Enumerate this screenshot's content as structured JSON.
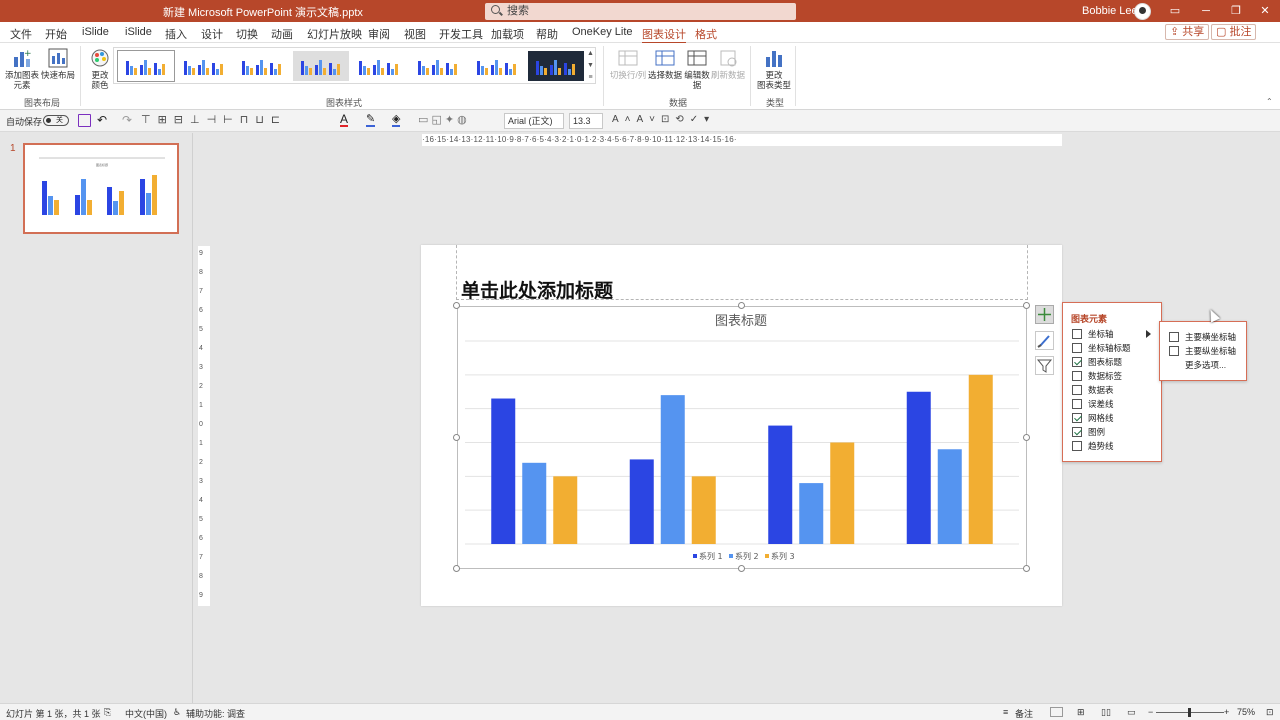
{
  "window": {
    "title": "新建 Microsoft PowerPoint 演示文稿.pptx",
    "search_placeholder": "搜索",
    "user_name": "Bobbie Lee"
  },
  "menu": {
    "tabs": [
      "文件",
      "开始",
      "iSlide",
      "iSlide",
      "插入",
      "设计",
      "切换",
      "动画",
      "幻灯片放映",
      "审阅",
      "视图",
      "开发工具",
      "加载项",
      "帮助",
      "OneKey Lite",
      "图表设计",
      "格式"
    ],
    "active_tab": "图表设计",
    "share_label": "共享",
    "comment_label": "批注"
  },
  "ribbon": {
    "add_chart_element": "添加图表\n元素",
    "quick_layout": "快速布局",
    "change_colors": "更改\n颜色",
    "switch_row_col": "切换行/列",
    "select_data": "选择数据",
    "edit_data": "编辑数\n据",
    "refresh_data": "刷新数据",
    "change_chart_type": "更改\n图表类型",
    "groups": {
      "layouts": "图表布局",
      "styles": "图表样式",
      "data": "数据",
      "type": "类型"
    }
  },
  "format_bar": {
    "autosave_label": "自动保存",
    "autosave_state": "关",
    "font_name": "Arial (正文)",
    "font_size": "13.3"
  },
  "ruler": {
    "horizontal": "·16·15·14·13·12·11·10·9·8·7·6·5·4·3·2·1·0·1·2·3·4·5·6·7·8·9·10·11·12·13·14·15·16·",
    "vertical": [
      "9",
      "8",
      "7",
      "6",
      "5",
      "4",
      "3",
      "2",
      "1",
      "0",
      "1",
      "2",
      "3",
      "4",
      "5",
      "6",
      "7",
      "8",
      "9"
    ]
  },
  "slides_panel": {
    "slide_number": "1"
  },
  "slide": {
    "title": "单击此处添加标题"
  },
  "chart_data": {
    "type": "bar",
    "title": "图表标题",
    "categories": [
      "",
      "",
      "",
      ""
    ],
    "series": [
      {
        "name": "系列 1",
        "values": [
          4.3,
          2.5,
          3.5,
          4.5
        ],
        "color": "#2b45e3"
      },
      {
        "name": "系列 2",
        "values": [
          2.4,
          4.4,
          1.8,
          2.8
        ],
        "color": "#5594f0"
      },
      {
        "name": "系列 3",
        "values": [
          2.0,
          2.0,
          3.0,
          5.0
        ],
        "color": "#f2ae32"
      }
    ],
    "ylim": [
      0,
      6
    ],
    "grid": true,
    "legend": "bottom"
  },
  "chart_elements_flyout": {
    "title": "图表元素",
    "items": [
      {
        "label": "坐标轴",
        "checked": false
      },
      {
        "label": "坐标轴标题",
        "checked": false
      },
      {
        "label": "图表标题",
        "checked": true
      },
      {
        "label": "数据标签",
        "checked": false
      },
      {
        "label": "数据表",
        "checked": false
      },
      {
        "label": "误差线",
        "checked": false
      },
      {
        "label": "网格线",
        "checked": true
      },
      {
        "label": "图例",
        "checked": true
      },
      {
        "label": "趋势线",
        "checked": false
      }
    ],
    "submenu": {
      "items": [
        "主要横坐标轴",
        "主要纵坐标轴"
      ],
      "more": "更多选项..."
    }
  },
  "statusbar": {
    "slide_info": "幻灯片 第 1 张，共 1 张",
    "language": "中文(中国)",
    "accessibility": "辅助功能: 调查",
    "notes": "备注",
    "zoom": "75%"
  },
  "colors": {
    "accent": "#b7472a"
  }
}
